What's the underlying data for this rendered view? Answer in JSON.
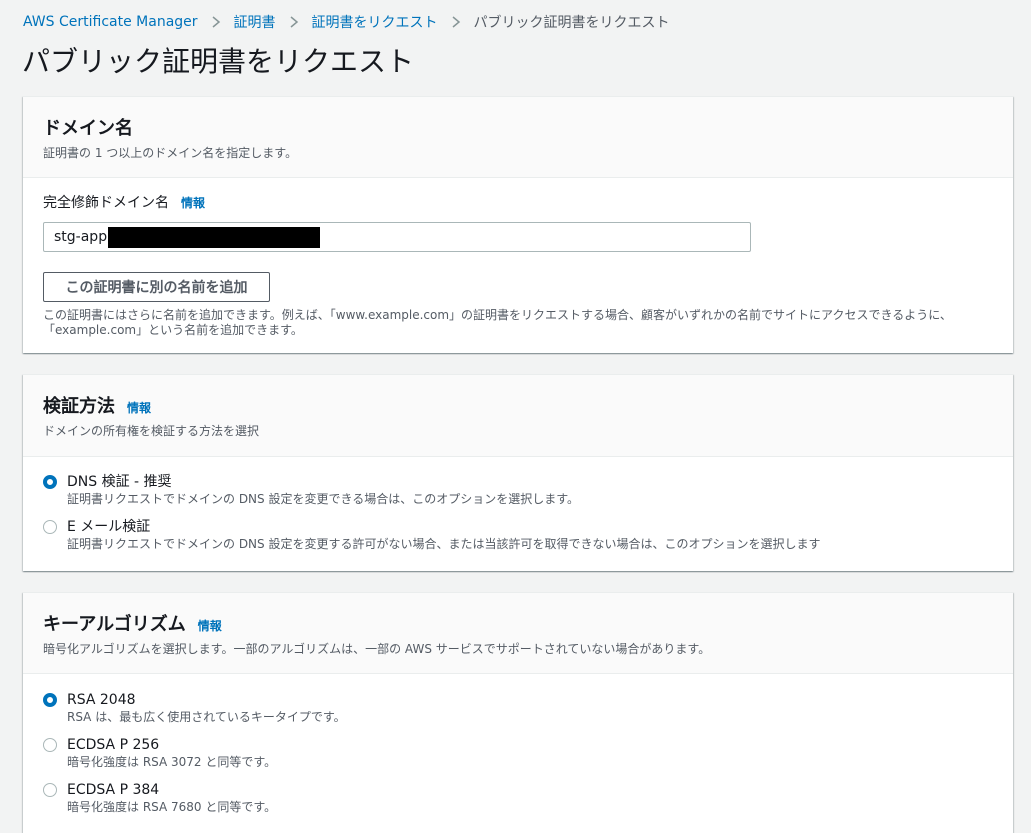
{
  "breadcrumb": [
    {
      "label": "AWS Certificate Manager"
    },
    {
      "label": "証明書"
    },
    {
      "label": "証明書をリクエスト"
    },
    {
      "label": "パブリック証明書をリクエスト"
    }
  ],
  "page_title": "パブリック証明書をリクエスト",
  "domain_panel": {
    "title": "ドメイン名",
    "description": "証明書の 1 つ以上のドメイン名を指定します。",
    "field_label": "完全修飾ドメイン名",
    "info": "情報",
    "input_value": "stg-app.",
    "add_button": "この証明書に別の名前を追加",
    "hint_line1": "この証明書にはさらに名前を追加できます。例えば、「www.example.com」の証明書をリクエストする場合、顧客がいずれかの名前でサイトにアクセスできるように、",
    "hint_line2": "「example.com」という名前を追加できます。"
  },
  "validation_panel": {
    "title": "検証方法",
    "info": "情報",
    "description": "ドメインの所有権を検証する方法を選択",
    "options": [
      {
        "label": "DNS 検証 - 推奨",
        "description": "証明書リクエストでドメインの DNS 設定を変更できる場合は、このオプションを選択します。",
        "selected": true
      },
      {
        "label": "E メール検証",
        "description": "証明書リクエストでドメインの DNS 設定を変更する許可がない場合、または当該許可を取得できない場合は、このオプションを選択します",
        "selected": false
      }
    ]
  },
  "algorithm_panel": {
    "title": "キーアルゴリズム",
    "info": "情報",
    "description": "暗号化アルゴリズムを選択します。一部のアルゴリズムは、一部の AWS サービスでサポートされていない場合があります。",
    "options": [
      {
        "label": "RSA 2048",
        "description": "RSA は、最も広く使用されているキータイプです。",
        "selected": true
      },
      {
        "label": "ECDSA P 256",
        "description": "暗号化強度は RSA 3072 と同等です。",
        "selected": false
      },
      {
        "label": "ECDSA P 384",
        "description": "暗号化強度は RSA 7680 と同等です。",
        "selected": false
      }
    ]
  },
  "colors": {
    "link": "#0073bb",
    "radio_selected": "#0073bb",
    "background": "#f2f3f3"
  }
}
